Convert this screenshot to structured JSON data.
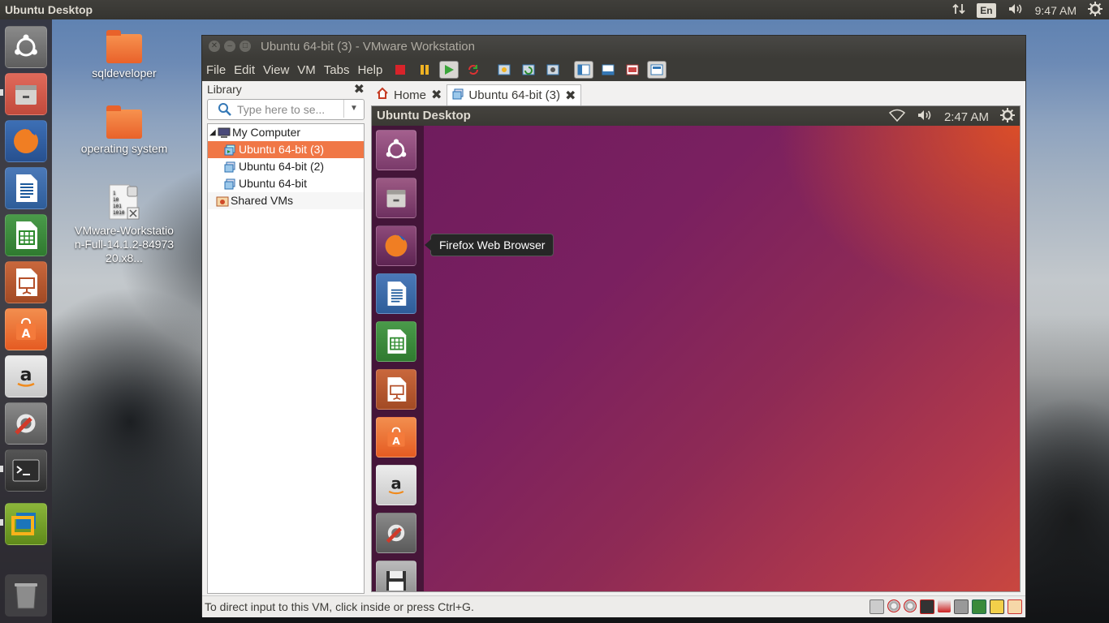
{
  "top_panel": {
    "title": "Ubuntu Desktop",
    "keyboard": "En",
    "time": "9:47 AM",
    "icons": [
      "network-arrows-icon",
      "volume-icon",
      "gear-icon"
    ]
  },
  "launcher": {
    "items": [
      "ubuntu-dash-icon",
      "files-icon",
      "firefox-icon",
      "writer-icon",
      "calc-icon",
      "impress-icon",
      "software-center-icon",
      "amazon-icon",
      "system-settings-icon",
      "terminal-icon",
      "vmware-icon",
      "trash-icon"
    ]
  },
  "desktop": {
    "icons": [
      {
        "label": "sqldeveloper"
      },
      {
        "label": "operating system"
      },
      {
        "label": "VMware-Workstation-Full-14.1.2-8497320.x8..."
      }
    ]
  },
  "vmware": {
    "title": "Ubuntu 64-bit (3) - VMware Workstation",
    "menu": [
      "File",
      "Edit",
      "View",
      "VM",
      "Tabs",
      "Help"
    ],
    "library": {
      "title": "Library",
      "search_placeholder": "Type here to se...",
      "tree": [
        {
          "label": "My Computer",
          "level": 0,
          "selected": false
        },
        {
          "label": "Ubuntu 64-bit (3)",
          "level": 1,
          "selected": true
        },
        {
          "label": "Ubuntu 64-bit (2)",
          "level": 1,
          "selected": false
        },
        {
          "label": "Ubuntu 64-bit",
          "level": 1,
          "selected": false
        },
        {
          "label": "Shared VMs",
          "level": 0,
          "selected": false
        }
      ]
    },
    "tabs": [
      {
        "label": "Home",
        "active": false
      },
      {
        "label": "Ubuntu 64-bit (3)",
        "active": true
      }
    ],
    "status": "To direct input to this VM, click inside or press Ctrl+G."
  },
  "guest": {
    "title": "Ubuntu Desktop",
    "time": "2:47 AM",
    "tooltip": "Firefox Web Browser"
  },
  "colors": {
    "ubuntu_orange": "#e95420",
    "selection": "#f07746",
    "panel": "#3c3b37"
  }
}
